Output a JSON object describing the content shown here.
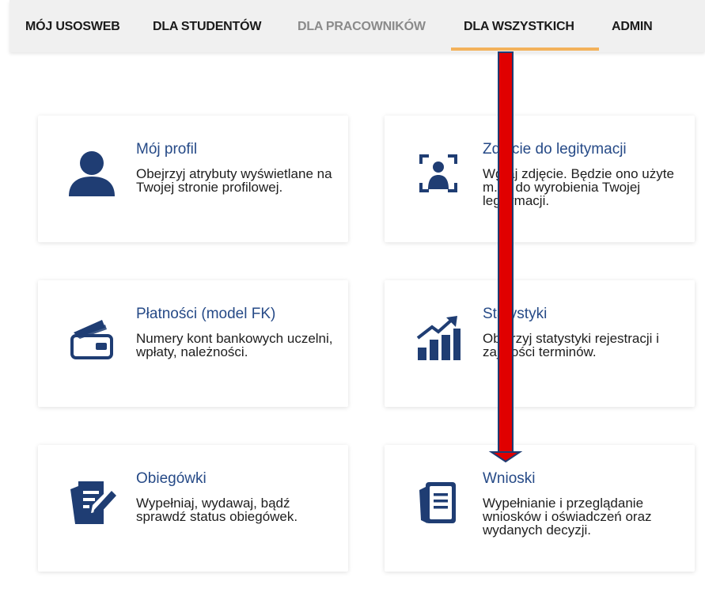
{
  "nav": {
    "items": [
      {
        "label": "MÓJ USOSWEB"
      },
      {
        "label": "DLA STUDENTÓW"
      },
      {
        "label": "DLA PRACOWNIKÓW"
      },
      {
        "label": "DLA WSZYSTKICH"
      },
      {
        "label": "ADMIN"
      }
    ],
    "active": "DLA WSZYSTKICH",
    "accent_color": "#f3b25b"
  },
  "cards": [
    {
      "title": "Mój profil",
      "description": "Obejrzyj atrybuty wyświetlane na Twojej stronie profilowej.",
      "icon": "user-icon"
    },
    {
      "title": "Zdjęcie do legitymacji",
      "description": "Wgraj zdjęcie. Będzie ono użyte m.in. do wyrobienia Twojej legitymacji.",
      "icon": "photo-id-icon"
    },
    {
      "title": "Płatności (model FK)",
      "description": "Numery kont bankowych uczelni, wpłaty, należności.",
      "icon": "wallet-icon"
    },
    {
      "title": "Statystyki",
      "description": "Obejrzyj statystyki rejestracji i zajętości terminów.",
      "icon": "statistics-icon"
    },
    {
      "title": "Obiegówki",
      "description": "Wypełniaj, wydawaj, bądź sprawdź status obiegówek.",
      "icon": "clearance-form-icon"
    },
    {
      "title": "Wnioski",
      "description": "Wypełnianie i przeglądanie wniosków i oświadczeń oraz wydanych decyzji.",
      "icon": "applications-icon"
    }
  ],
  "colors": {
    "title": "#264a87",
    "icon": "#1f3d73",
    "annotation_arrow": "#e00000"
  }
}
